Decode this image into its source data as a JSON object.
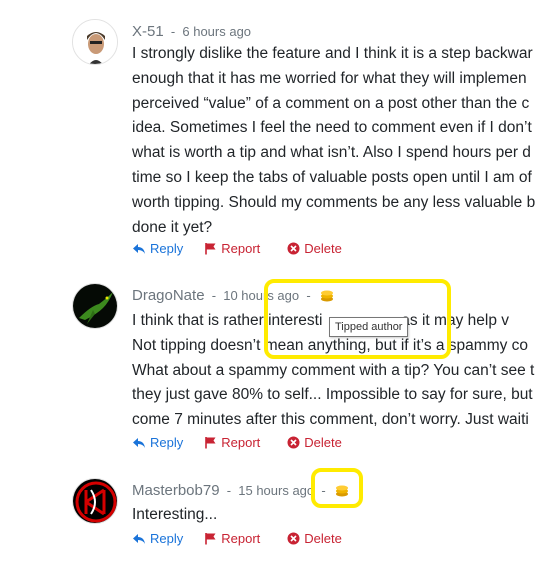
{
  "comments": [
    {
      "author": "X-51",
      "separator": "-",
      "time": "6 hours ago",
      "lines": [
        "I strongly dislike the feature and I think it is a step backwar",
        "enough that it has me worried for what they will implemen",
        "perceived “value” of a comment on a post other than the c",
        "idea. Sometimes I feel the need to comment even if I don’t",
        "what is worth a tip and what isn’t. Also I spend hours per d",
        "time so I keep the tabs of valuable posts open until I am of",
        "worth tipping. Should my comments be any less valuable b",
        "done it yet?"
      ],
      "tipped": false
    },
    {
      "author": "DragoNate",
      "separator": "-",
      "time": "10 hours ago",
      "lines": [
        "I think that is rather interesti",
        "Not tipping doesn’t mean anything, but if it’s a spammy co",
        "What about a spammy comment with a tip? You can’t see t",
        "they just gave 80% to self... Impossible to say for sure, but",
        "come 7 minutes after this comment, don’t worry. Just waiti"
      ],
      "line1_tail": "...as it may help v",
      "tipped": true
    },
    {
      "author": "Masterbob79",
      "separator": "-",
      "time": "15 hours ago",
      "lines": [
        "Interesting..."
      ],
      "tipped": true
    }
  ],
  "actions": {
    "reply": "Reply",
    "report": "Report",
    "delete": "Delete"
  },
  "tooltip": "Tipped author",
  "colors": {
    "reply": "#1a73d9",
    "report": "#c82333",
    "highlight": "#ffeb00",
    "coin": "#e6a800"
  },
  "icons": {
    "reply": "reply-arrow-icon",
    "report": "flag-icon",
    "delete": "x-circle-icon",
    "tip": "coin-stack-icon"
  }
}
